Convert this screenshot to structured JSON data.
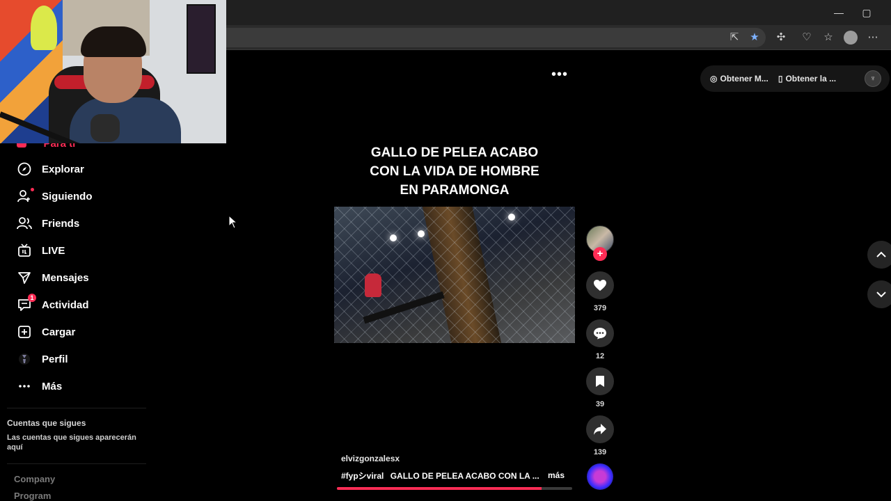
{
  "browser": {
    "minimize": "—",
    "maximize": "▢",
    "toolbar_icons": [
      "open-in-new-icon",
      "favorite-star-icon",
      "extensions-icon",
      "performance-icon",
      "favorites-icon",
      "profile-icon",
      "more-icon"
    ]
  },
  "sidebar": {
    "partial_item": "Para ti",
    "items": [
      {
        "label": "Explorar",
        "icon": "compass-icon"
      },
      {
        "label": "Siguiendo",
        "icon": "following-icon"
      },
      {
        "label": "Friends",
        "icon": "friends-icon"
      },
      {
        "label": "LIVE",
        "icon": "live-tv-icon"
      },
      {
        "label": "Mensajes",
        "icon": "messages-icon"
      },
      {
        "label": "Actividad",
        "icon": "activity-icon",
        "badge": "1"
      },
      {
        "label": "Cargar",
        "icon": "upload-icon"
      },
      {
        "label": "Perfil",
        "icon": "profile-icon"
      },
      {
        "label": "Más",
        "icon": "more-dots-icon"
      }
    ],
    "following_title": "Cuentas que sigues",
    "following_desc": "Las cuentas que sigues aparecerán aquí",
    "footer": [
      "Company",
      "Program"
    ]
  },
  "top_bar": {
    "get_app_label": "Obtener M...",
    "get_device_label": "Obtener la ..."
  },
  "video": {
    "title_lines": [
      "GALLO DE PELEA ACABO",
      "CON LA VIDA DE HOMBRE",
      "EN PARAMONGA"
    ],
    "username": "elvizgonzalesx",
    "hashtag": "#fypシviral",
    "caption": "GALLO DE PELEA ACABO CON LA ...",
    "more_label": "más",
    "progress": 0.87
  },
  "actions": {
    "likes": "379",
    "comments": "12",
    "saves": "39",
    "shares": "139"
  },
  "colors": {
    "accent": "#fe2c55",
    "background": "#000000",
    "button_bg": "#2f2f2f"
  }
}
